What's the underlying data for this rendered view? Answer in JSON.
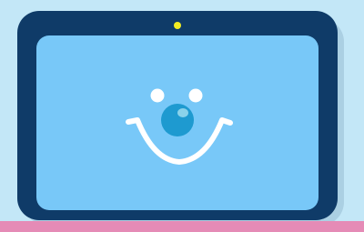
{
  "scene": {
    "illustration": "smiling-tablet",
    "colors": {
      "background": "#c3e7f7",
      "tablet_body": "#0f3b68",
      "screen": "#78c8f8",
      "camera": "#f2ec22",
      "face_features": "#ffffff",
      "nose": "#1e9ad0",
      "nose_highlight": "#8ad2ea",
      "floor_stripe": "#e58bb6"
    },
    "icons": [
      "tablet-icon",
      "camera-icon",
      "smile-face-icon"
    ]
  }
}
